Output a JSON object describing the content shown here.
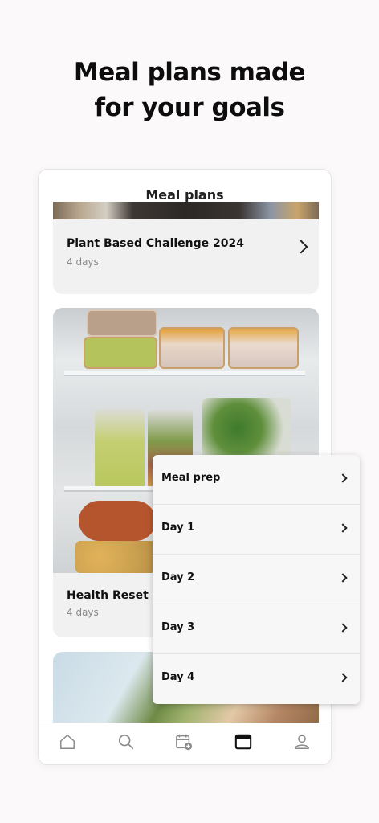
{
  "hero": {
    "line1": "Meal plans made",
    "line2": "for your goals"
  },
  "screen": {
    "title": "Meal plans"
  },
  "cards": [
    {
      "title": "Plant Based Challenge 2024",
      "subtitle": "4 days"
    },
    {
      "title": "Health Reset",
      "subtitle": "4 days"
    },
    {
      "title": "",
      "subtitle": ""
    }
  ],
  "dropdown": {
    "items": [
      {
        "label": "Meal prep"
      },
      {
        "label": "Day 1"
      },
      {
        "label": "Day 2"
      },
      {
        "label": "Day 3"
      },
      {
        "label": "Day 4"
      }
    ]
  },
  "nav": {
    "items": [
      {
        "icon": "home-icon"
      },
      {
        "icon": "search-icon"
      },
      {
        "icon": "calendar-add-icon"
      },
      {
        "icon": "meal-plans-icon",
        "active": true
      },
      {
        "icon": "profile-icon"
      }
    ]
  },
  "colors": {
    "background": "#fbf9f9",
    "card": "#f2f1f1",
    "text": "#111111",
    "muted": "#888888"
  }
}
